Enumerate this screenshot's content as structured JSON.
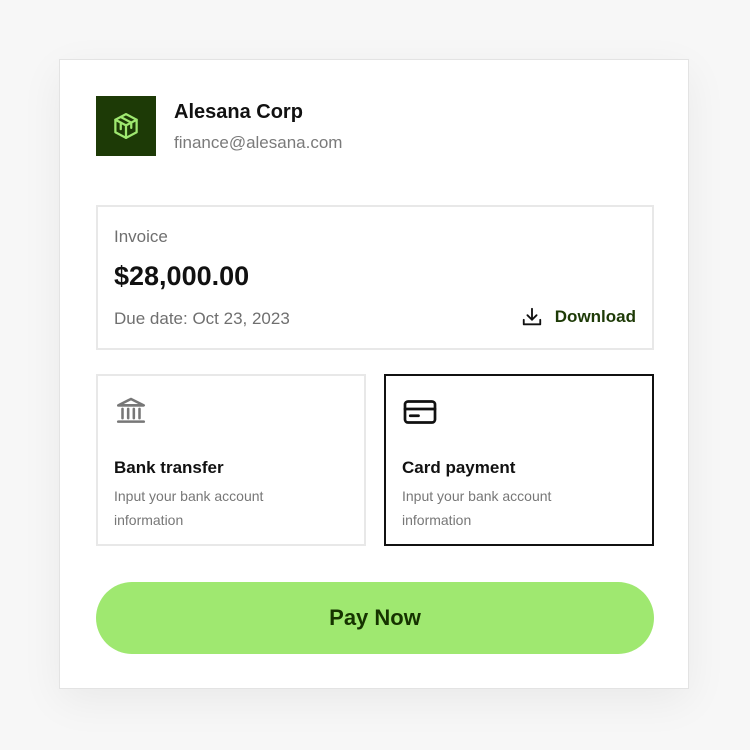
{
  "company": {
    "name": "Alesana Corp",
    "email": "finance@alesana.com",
    "logo_icon": "cube-logo-icon",
    "logo_bg": "#1d3a06",
    "logo_fg": "#9fe870"
  },
  "invoice": {
    "label": "Invoice",
    "amount": "$28,000.00",
    "due_date": "Due date: Oct 23, 2023",
    "download_label": "Download",
    "download_icon": "download-icon"
  },
  "payment_methods": [
    {
      "title": "Bank transfer",
      "description": "Input your bank account information",
      "icon": "bank-icon",
      "selected": false
    },
    {
      "title": "Card payment",
      "description": "Input your bank account information",
      "icon": "credit-card-icon",
      "selected": true
    }
  ],
  "pay_button": {
    "label": "Pay Now",
    "color": "#9fe870",
    "text_color": "#163300"
  }
}
